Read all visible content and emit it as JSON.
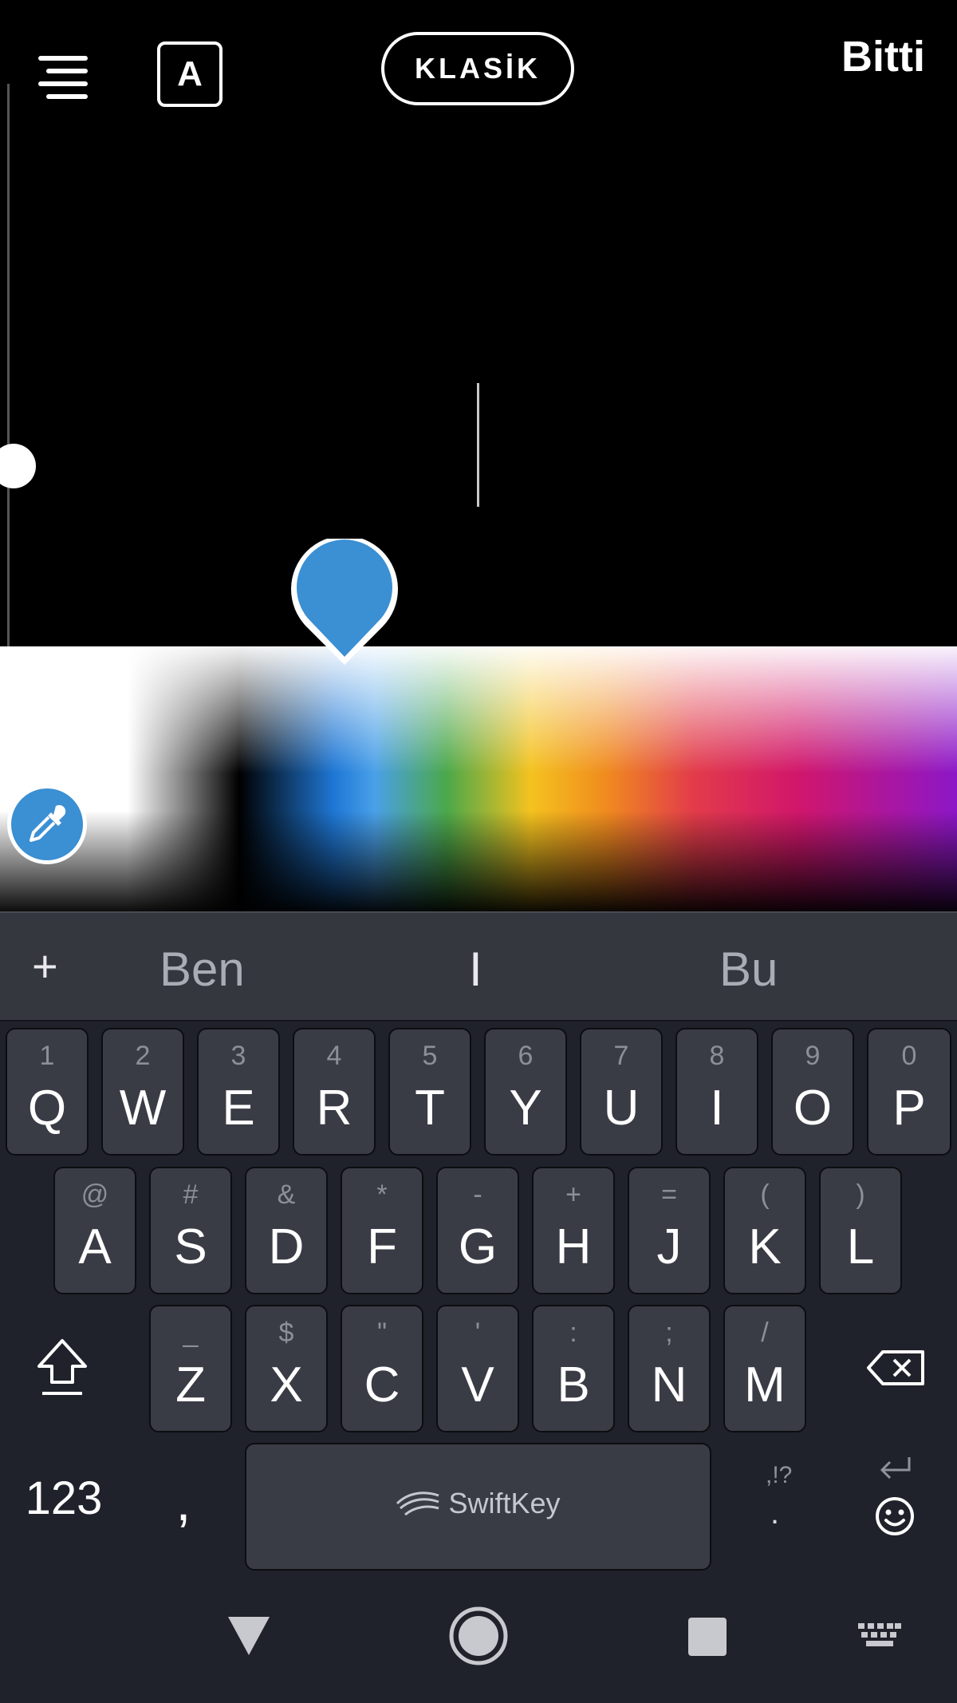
{
  "toolbar": {
    "text_style_label": "A",
    "style_label": "KLASİK",
    "done_label": "Bitti"
  },
  "color_picker": {
    "selected_color": "#3b8fd3"
  },
  "keyboard": {
    "suggestions": [
      "Ben",
      "I",
      "Bu"
    ],
    "row1": [
      {
        "hint": "1",
        "key": "Q"
      },
      {
        "hint": "2",
        "key": "W"
      },
      {
        "hint": "3",
        "key": "E"
      },
      {
        "hint": "4",
        "key": "R"
      },
      {
        "hint": "5",
        "key": "T"
      },
      {
        "hint": "6",
        "key": "Y"
      },
      {
        "hint": "7",
        "key": "U"
      },
      {
        "hint": "8",
        "key": "I"
      },
      {
        "hint": "9",
        "key": "O"
      },
      {
        "hint": "0",
        "key": "P"
      }
    ],
    "row2": [
      {
        "hint": "@",
        "key": "A"
      },
      {
        "hint": "#",
        "key": "S"
      },
      {
        "hint": "&",
        "key": "D"
      },
      {
        "hint": "*",
        "key": "F"
      },
      {
        "hint": "-",
        "key": "G"
      },
      {
        "hint": "+",
        "key": "H"
      },
      {
        "hint": "=",
        "key": "J"
      },
      {
        "hint": "(",
        "key": "K"
      },
      {
        "hint": ")",
        "key": "L"
      }
    ],
    "row3": [
      {
        "hint": "_",
        "key": "Z"
      },
      {
        "hint": "$",
        "key": "X"
      },
      {
        "hint": "\"",
        "key": "C"
      },
      {
        "hint": "'",
        "key": "V"
      },
      {
        "hint": ":",
        "key": "B"
      },
      {
        "hint": ";",
        "key": "N"
      },
      {
        "hint": "/",
        "key": "M"
      }
    ],
    "numbers_label": "123",
    "comma_label": ",",
    "space_brand": "SwiftKey",
    "period_hint": ",!?",
    "period_label": "."
  },
  "icons": {
    "menu": "menu-icon",
    "eyedropper": "eyedropper-icon",
    "shift": "shift-icon",
    "backspace": "backspace-icon",
    "enter": "enter-icon",
    "emoji": "emoji-icon",
    "back": "back-triangle-icon",
    "home": "home-circle-icon",
    "recents": "recents-square-icon",
    "keyboard": "keyboard-icon"
  }
}
